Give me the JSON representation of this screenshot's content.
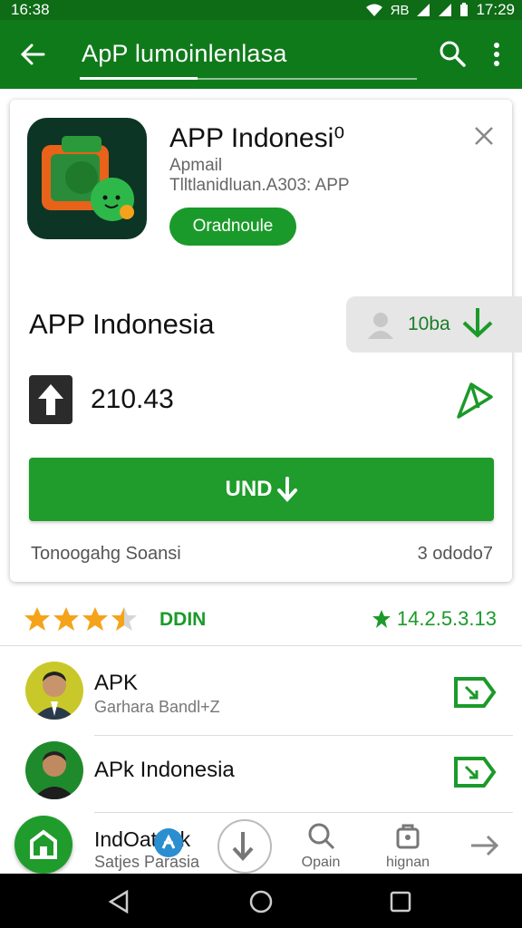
{
  "status_bar": {
    "time_left": "16:38",
    "time_right": "17:29",
    "network_label": "ЯВ"
  },
  "app_bar": {
    "back_icon": "arrow-left-icon",
    "title": "ApP lumoinlenlasa",
    "search_icon": "search-icon",
    "menu_icon": "more-vert-icon"
  },
  "app_card": {
    "name": "APP Indonesi⁰",
    "developer": "Apmail",
    "subtitle": "Tlltlanidluan.A303: APP",
    "open_button": "Oradnoule",
    "close_icon": "close-icon"
  },
  "detail": {
    "heading": "APP Indonesia",
    "size_label": "10ba",
    "version_value": "210.43",
    "install_button": "UND",
    "footer_left": "Tonoogahg Soansi",
    "footer_right": "3 ododo7"
  },
  "rating": {
    "stars": 3.5,
    "max_stars": 5,
    "label": "DDIN",
    "score": "14.2.5.3.13"
  },
  "list": [
    {
      "title": "APK",
      "subtitle": "Garhara Bandl+Z"
    },
    {
      "title": "APk Indonesia",
      "subtitle": ""
    },
    {
      "title": "IndOatunk",
      "subtitle": "Satjes Parasia"
    }
  ],
  "bottom_tabs": [
    {
      "label": "",
      "icon": "download-icon"
    },
    {
      "label": "Opain",
      "icon": "search-icon"
    },
    {
      "label": "hignan",
      "icon": "bag-icon"
    },
    {
      "label": "",
      "icon": "arrow-right-icon"
    }
  ],
  "colors": {
    "primary": "#0f7a1a",
    "accent": "#1f9c2b",
    "star": "#f5a31a"
  }
}
